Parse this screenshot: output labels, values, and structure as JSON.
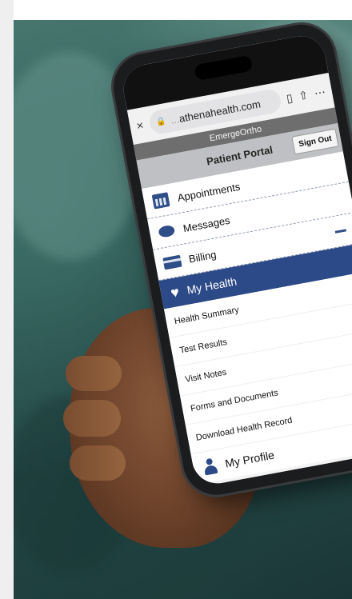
{
  "browser": {
    "url_faded": "...",
    "url_domain": "athenahealth.com",
    "close_label": "×"
  },
  "header": {
    "org_name": "EmergeOrtho",
    "portal_title": "Patient Portal",
    "signout_label": "Sign Out"
  },
  "menu": {
    "appointments": "Appointments",
    "messages": "Messages",
    "billing": "Billing",
    "my_health": "My Health",
    "my_profile": "My Profile"
  },
  "health_items": [
    {
      "label": "Health Summary"
    },
    {
      "label": "Test Results"
    },
    {
      "label": "Visit Notes"
    },
    {
      "label": "Forms and Documents"
    },
    {
      "label": "Download Health Record"
    }
  ],
  "colors": {
    "accent": "#2c4a88",
    "org_bar": "#6e6e6e",
    "portal_bar": "#bfc0c3"
  },
  "icons": {
    "appointments": "calendar-icon",
    "messages": "chat-bubble-icon",
    "billing": "credit-card-icon",
    "my_health": "heart-icon",
    "my_profile": "person-icon"
  }
}
